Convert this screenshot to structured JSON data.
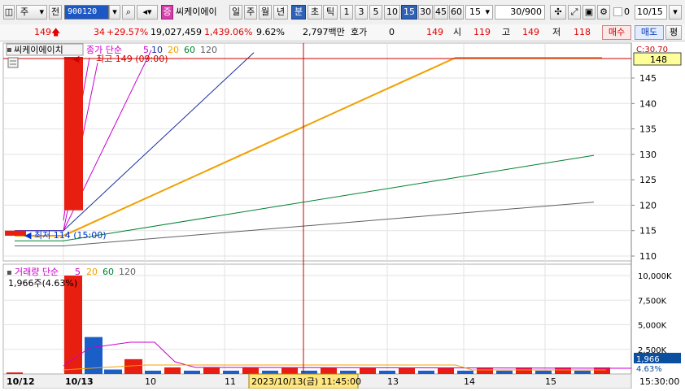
{
  "toolbar": {
    "market_label": "주",
    "type_label": "전",
    "code": "900120",
    "stock_badge": "증",
    "stock_name": "씨케이에이",
    "periods": [
      "일",
      "주",
      "월",
      "년",
      "분",
      "초",
      "틱"
    ],
    "active_period": "분",
    "intervals": [
      "1",
      "3",
      "5",
      "10",
      "15",
      "30",
      "45",
      "60"
    ],
    "active_interval": "15",
    "interval_value": "15",
    "count_value": "30",
    "count_max": "/900",
    "check_label": "0",
    "date_value": "10/15"
  },
  "quote": {
    "price": "149",
    "change": "34",
    "change_pct": "+29.57%",
    "volume": "19,027,459",
    "volume_pct": "1,439.06%",
    "turnover": "9.62%",
    "amount": "2,797백만",
    "hoga_label": "호가",
    "hoga_value": "0",
    "current": "149",
    "open_label": "시",
    "open": "119",
    "high_label": "고",
    "high": "149",
    "low_label": "저",
    "low": "118",
    "buy_label": "매수",
    "sell_label": "매도",
    "avg_label": "평"
  },
  "chart": {
    "name_label": "씨케이에이치",
    "price_legend": {
      "prefix": "종가 단순",
      "periods": [
        "5",
        "10",
        "20",
        "60",
        "120"
      ],
      "colors": [
        "#cc00cc",
        "#1a2fa0",
        "#f0a000",
        "#008030",
        "#606060"
      ]
    },
    "high_annotation": "최고 149 (09:00)",
    "low_annotation": "최저 114 (15:00)",
    "c_label": "C:30.70",
    "current_tag": "148",
    "price_ticks": [
      "145",
      "140",
      "135",
      "130",
      "125",
      "120",
      "115",
      "110"
    ],
    "volume_legend": {
      "prefix": "거래량 단순",
      "periods": [
        "5",
        "20",
        "60",
        "120"
      ],
      "colors": [
        "#cc00cc",
        "#f0a000",
        "#008030",
        "#606060"
      ]
    },
    "volume_info": "1,966주(4.63%)",
    "volume_ticks": [
      "10,000K",
      "7,500K",
      "5,000K",
      "2,500K"
    ],
    "volume_current_tag": "1,966",
    "volume_pct_tag": "4.63%",
    "date_labels": [
      "10/12",
      "10/13",
      "10",
      "11",
      "13",
      "14",
      "15"
    ],
    "cursor_time": "2023/10/13(금) 11:45:00",
    "end_time": "15:30:00",
    "colors": {
      "up": "#e81e10",
      "down": "#1a5fc8",
      "cursor": "#cc0000",
      "tag_bg": "#ffff99",
      "vol_tag_bg": "#0b4fa0"
    }
  },
  "chart_data": {
    "type": "candlestick",
    "price_range": [
      109,
      150
    ],
    "volume_range_k": [
      0,
      11000
    ],
    "candles": [
      {
        "time": "10/12 15:00",
        "open": 114,
        "close": 115,
        "high": 115,
        "low": 114,
        "volume_k": 150
      },
      {
        "time": "10/13 09:00",
        "open": 119,
        "close": 149,
        "high": 149,
        "low": 118,
        "volume_k": 10000
      },
      {
        "time": "10/13 09:15",
        "open": 149,
        "close": 149,
        "high": 149,
        "low": 149,
        "volume_k": 3750
      },
      {
        "time": "10/13 09:30",
        "open": 149,
        "close": 149,
        "high": 149,
        "low": 149,
        "volume_k": 450
      },
      {
        "time": "10/13 09:45",
        "open": 149,
        "close": 149,
        "high": 149,
        "low": 149,
        "volume_k": 1500
      }
    ],
    "moving_averages": [
      {
        "name": "5",
        "start": 115,
        "end": 149
      },
      {
        "name": "10",
        "start": 115,
        "end": 149
      },
      {
        "name": "20",
        "start": 114,
        "end": 149
      },
      {
        "name": "60",
        "start": 113,
        "end": 129.8
      },
      {
        "name": "120",
        "start": 112,
        "end": 120.6
      }
    ]
  }
}
